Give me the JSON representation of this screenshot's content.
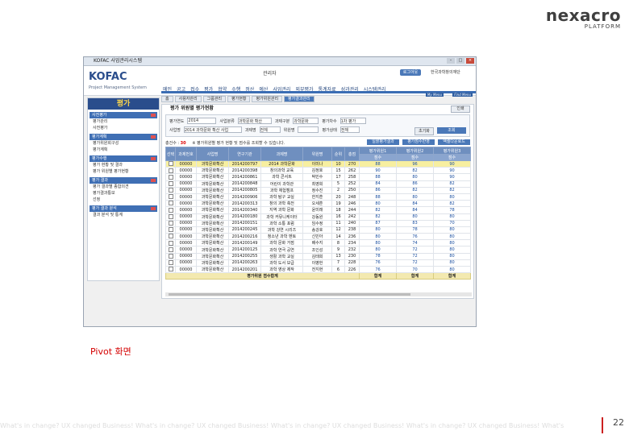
{
  "brand": {
    "logo_main": "nexacro",
    "logo_sub": "PLATFORM"
  },
  "window": {
    "title": "KOFAC 사업관리시스템"
  },
  "app": {
    "logo": "KOFAC",
    "subtitle": "Project Management System",
    "admin": "관리자",
    "logout": "로그아웃",
    "org": "한국과학창의재단",
    "menu": [
      "메인",
      "공고",
      "접수",
      "평가",
      "협약",
      "수행",
      "정산",
      "예산",
      "사업관리",
      "외부평가",
      "통계자료",
      "성과관리",
      "시스템관리"
    ]
  },
  "subtabs": {
    "items": [
      "홈",
      "사용자관리",
      "그룹관리",
      "평가현황",
      "평가위원관리",
      "평가결과관리"
    ],
    "active_index": 5,
    "tag1": "My Menu",
    "tag2": "Find Menu"
  },
  "sidebar": {
    "title": "평가",
    "groups": [
      {
        "label": "사전평가",
        "items": [
          "평가관리",
          "사전평가"
        ]
      },
      {
        "label": "평가계획",
        "items": [
          "평가위원회구성",
          "평가계획"
        ]
      },
      {
        "label": "평가수행",
        "items": [
          "평가 현황 및 결과",
          "평가 위원별 평가현황"
        ]
      },
      {
        "label": "평가 결과",
        "items": [
          "평가 결과별 종합의견",
          "평가결과통보",
          "선정"
        ]
      },
      {
        "label": "평가 결과 분석",
        "items": [
          "결과 분석 및 통계"
        ]
      }
    ]
  },
  "panel": {
    "title": "평가 위원별 평가현황",
    "print_button": "인쇄",
    "filters": {
      "row1": [
        "평가연도",
        "2014",
        "사업분류",
        "과학문화 확산",
        "과제구분",
        "과학문화",
        "평가차수",
        "1차 평가"
      ],
      "row2": [
        "사업명",
        "2014 과학문화 확산 사업",
        "과제명",
        "전체",
        "위원명",
        "",
        "평가상태",
        "전체"
      ],
      "search_button": "조회",
      "reset_button": "초기화"
    },
    "count_label": "총건수 :",
    "count_value": "30",
    "note": "※ 평가위원별 평가 현황 및 점수를 조회할 수 있습니다.",
    "tool_buttons": [
      "일괄평가결과",
      "평가점수반영",
      "엑셀다운로드"
    ]
  },
  "grid": {
    "headers": [
      "선택",
      "과제번호",
      "사업명",
      "연구기관",
      "과제명",
      "위원명",
      "순위",
      "총점"
    ],
    "group_headers": [
      "평가위원1",
      "평가위원2",
      "평가위원3"
    ],
    "sub_headers": [
      "점수",
      "점수",
      "점수"
    ],
    "rows": [
      [
        "00000",
        "과학문화확산",
        "2014200797",
        "2014 과학문화",
        "이미나",
        "10",
        "270",
        "88",
        "96",
        "90"
      ],
      [
        "00000",
        "과학문화확산",
        "2014200398",
        "창의과학 교육",
        "김정호",
        "15",
        "262",
        "90",
        "82",
        "90"
      ],
      [
        "00000",
        "과학문화확산",
        "2014200861",
        "과학 콘서트",
        "박민수",
        "17",
        "258",
        "88",
        "80",
        "90"
      ],
      [
        "00000",
        "과학문화확산",
        "2014200848",
        "어린이 과학관",
        "최영희",
        "5",
        "252",
        "84",
        "86",
        "82"
      ],
      [
        "00000",
        "과학문화확산",
        "2014200805",
        "과학 체험캠프",
        "정수진",
        "2",
        "250",
        "86",
        "82",
        "82"
      ],
      [
        "00000",
        "과학문화확산",
        "2014200906",
        "과학 탐구 교실",
        "한지훈",
        "20",
        "248",
        "88",
        "80",
        "80"
      ],
      [
        "00000",
        "과학문화확산",
        "2014200313",
        "창의 과학 축전",
        "오세훈",
        "19",
        "246",
        "80",
        "84",
        "82"
      ],
      [
        "00000",
        "과학문화확산",
        "2014200340",
        "지역 과학 문화",
        "윤미래",
        "18",
        "244",
        "82",
        "84",
        "78"
      ],
      [
        "00000",
        "과학문화확산",
        "2014200180",
        "과학 커뮤니케이터",
        "강동원",
        "16",
        "242",
        "82",
        "80",
        "80"
      ],
      [
        "00000",
        "과학문화확산",
        "2014200151",
        "과학 소통 포럼",
        "임수정",
        "11",
        "240",
        "87",
        "83",
        "70"
      ],
      [
        "00000",
        "과학문화확산",
        "2014200245",
        "과학 강연 시리즈",
        "송강호",
        "12",
        "238",
        "80",
        "78",
        "80"
      ],
      [
        "00000",
        "과학문화확산",
        "2014200216",
        "청소년 과학 멘토",
        "신민아",
        "14",
        "236",
        "80",
        "76",
        "80"
      ],
      [
        "00000",
        "과학문화확산",
        "2014200149",
        "과학 문화 거점",
        "배수지",
        "8",
        "234",
        "80",
        "74",
        "80"
      ],
      [
        "00000",
        "과학문화확산",
        "2014200125",
        "과학 연극 공연",
        "조인성",
        "9",
        "232",
        "80",
        "72",
        "80"
      ],
      [
        "00000",
        "과학문화확산",
        "2014200255",
        "생활 과학 교실",
        "김태희",
        "13",
        "230",
        "78",
        "72",
        "80"
      ],
      [
        "00000",
        "과학문화확산",
        "2014200263",
        "과학 도서 보급",
        "이병헌",
        "7",
        "228",
        "76",
        "72",
        "80"
      ],
      [
        "00000",
        "과학문화확산",
        "2014200201",
        "과학 영상 제작",
        "전지현",
        "6",
        "226",
        "76",
        "70",
        "80"
      ]
    ],
    "sum_label": "평가위원 점수합계",
    "sum_values": [
      "합계",
      "합계",
      "합계"
    ]
  },
  "caption": "Pivot 화면",
  "footer": "What's in change? UX changed Business!  What's in change? UX changed Business!  What's in change? UX changed Business!  What's in change? UX changed Business!  What's in change? UX changed Business!",
  "page_number": "22"
}
